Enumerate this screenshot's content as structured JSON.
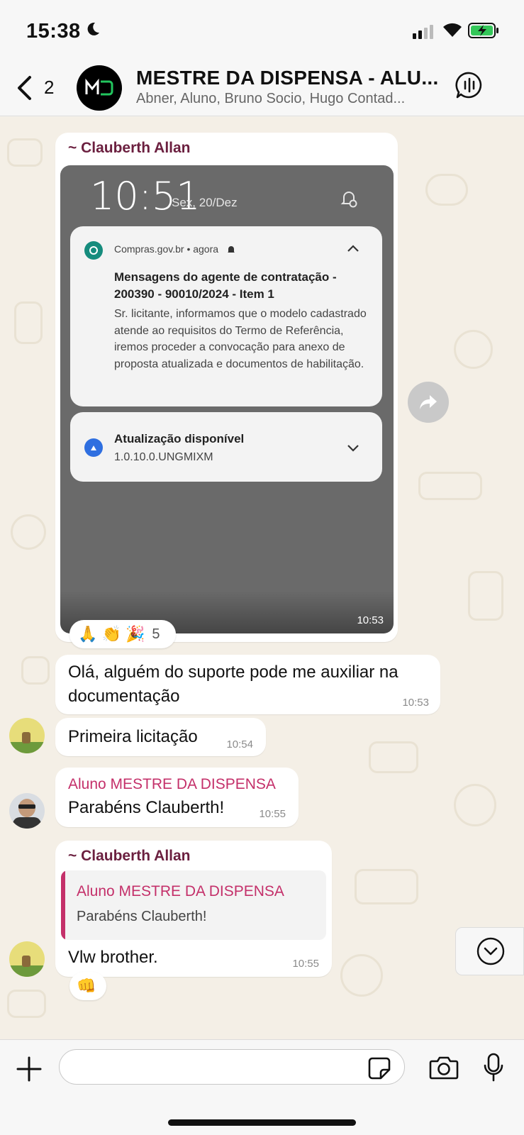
{
  "status": {
    "time": "15:38"
  },
  "header": {
    "back_count": "2",
    "title": "MESTRE DA DISPENSA - ALU...",
    "members": "Abner, Aluno, Bruno Socio, Hugo Contad..."
  },
  "messages": {
    "m1": {
      "sender": "~ Clauberth Allan",
      "time": "10:53",
      "screenshot": {
        "lock_time": "10:51",
        "lock_date": "Sex, 20/Dez",
        "notif1": {
          "app": "Compras.gov.br • agora",
          "title": "Mensagens do agente de contratação - 200390 - 90010/2024 - Item 1",
          "body": "Sr. licitante, informamos que o modelo cadastrado atende ao requisitos do Termo de Referência, iremos proceder a convocação para anexo de proposta atualizada e documentos de habilitação."
        },
        "notif2": {
          "title": "Atualização disponível",
          "body": "1.0.10.0.UNGMIXM"
        }
      },
      "reactions": {
        "emojis": "🙏 👏 🎉",
        "count": "5"
      }
    },
    "m2": {
      "text": "Olá, alguém do suporte pode me auxiliar na documentação",
      "time": "10:53"
    },
    "m3": {
      "text": "Primeira licitação",
      "time": "10:54"
    },
    "m4": {
      "sender": "Aluno MESTRE DA DISPENSA",
      "text": "Parabéns Clauberth!",
      "time": "10:55"
    },
    "m5": {
      "sender": "~ Clauberth Allan",
      "quote_sender": "Aluno MESTRE DA DISPENSA",
      "quote_text": "Parabéns Clauberth!",
      "text": "Vlw brother.",
      "time": "10:55",
      "reaction": "👊"
    }
  },
  "input": {
    "value": ""
  },
  "colors": {
    "sender_clauberth": "#6b1f3f",
    "sender_aluno": "#c4306a",
    "quote_bar": "#c4306a"
  }
}
